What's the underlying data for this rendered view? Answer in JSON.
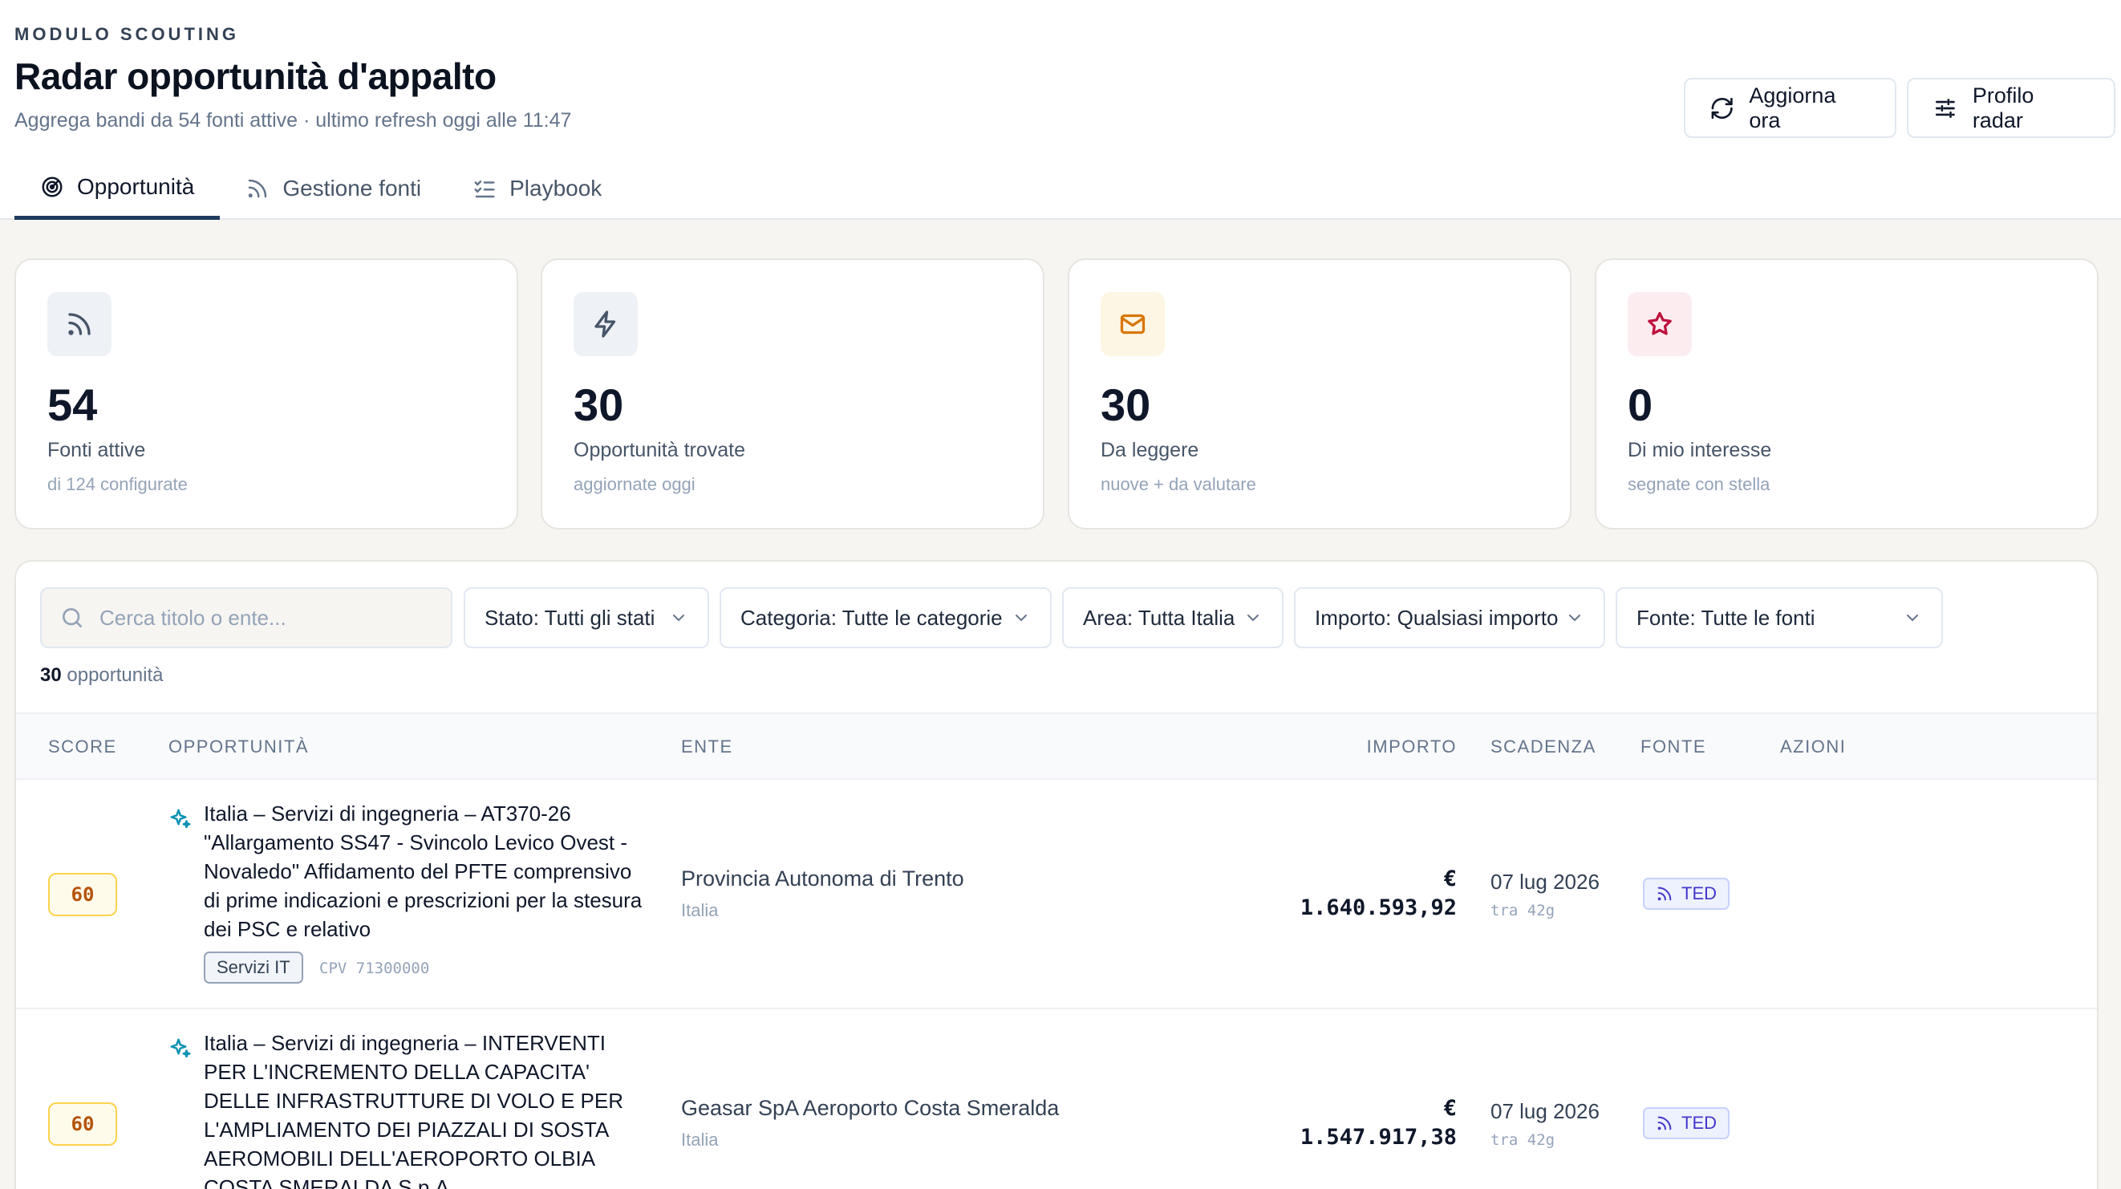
{
  "header": {
    "eyebrow": "MODULO SCOUTING",
    "title": "Radar opportunità d'appalto",
    "subtitle": "Aggrega bandi da 54 fonti attive · ultimo refresh oggi alle 11:47",
    "refresh_label": "Aggiorna ora",
    "profile_label": "Profilo radar"
  },
  "tabs": [
    {
      "label": "Opportunità",
      "icon": "radar-icon",
      "active": true
    },
    {
      "label": "Gestione fonti",
      "icon": "rss-icon",
      "active": false
    },
    {
      "label": "Playbook",
      "icon": "checklist-icon",
      "active": false
    }
  ],
  "stats": [
    {
      "value": "54",
      "label": "Fonti attive",
      "sub": "di 124 configurate",
      "icon": "rss-icon",
      "color": "#475569"
    },
    {
      "value": "30",
      "label": "Opportunità trovate",
      "sub": "aggiornate oggi",
      "icon": "bolt-icon",
      "color": "#475569"
    },
    {
      "value": "30",
      "label": "Da leggere",
      "sub": "nuove + da valutare",
      "icon": "mail-icon",
      "color": "#d97706"
    },
    {
      "value": "0",
      "label": "Di mio interesse",
      "sub": "segnate con stella",
      "icon": "star-icon",
      "color": "#be123c"
    }
  ],
  "filters": {
    "search_placeholder": "Cerca titolo o ente...",
    "selects": [
      "Stato: Tutti gli stati",
      "Categoria: Tutte le categorie",
      "Area: Tutta Italia",
      "Importo: Qualsiasi importo",
      "Fonte: Tutte le fonti"
    ],
    "count_num": "30",
    "count_label": "opportunità"
  },
  "table": {
    "columns": [
      "SCORE",
      "OPPORTUNITÀ",
      "ENTE",
      "IMPORTO",
      "SCADENZA",
      "FONTE",
      "AZIONI"
    ],
    "rows": [
      {
        "score": "60",
        "title": "Italia – Servizi di ingegneria – AT370-26 \"Allargamento SS47 - Svincolo Levico Ovest - Novaledo\" Affidamento del PFTE comprensivo di prime indicazioni e prescrizioni per la stesura dei PSC e relativo",
        "category": "Servizi IT",
        "cpv": "CPV 71300000",
        "ente": "Provincia Autonoma di Trento",
        "ente_area": "Italia",
        "importo_currency": "€",
        "importo": "1.640.593,92",
        "scadenza": "07 lug 2026",
        "scadenza_rel": "tra 42g",
        "fonte": "TED"
      },
      {
        "score": "60",
        "title": "Italia – Servizi di ingegneria – INTERVENTI PER L'INCREMENTO DELLA CAPACITA' DELLE INFRASTRUTTURE DI VOLO E PER L'AMPLIAMENTO DEI PIAZZALI DI SOSTA AEROMOBILI DELL'AEROPORTO OLBIA COSTA SMERALDA S.p.A.",
        "category": "",
        "cpv": "",
        "ente": "Geasar SpA Aeroporto Costa Smeralda",
        "ente_area": "Italia",
        "importo_currency": "€",
        "importo": "1.547.917,38",
        "scadenza": "07 lug 2026",
        "scadenza_rel": "tra 42g",
        "fonte": "TED"
      }
    ]
  }
}
